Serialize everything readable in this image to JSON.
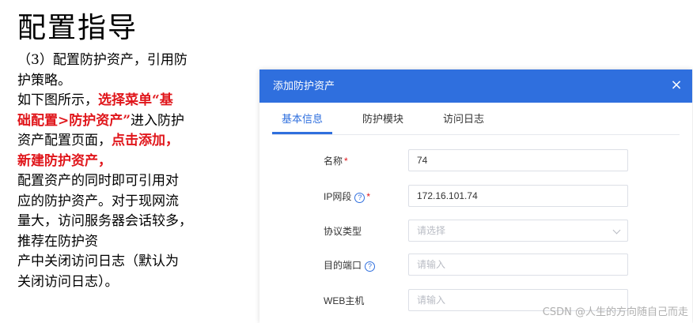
{
  "page_title": "配置指导",
  "instructions": {
    "line1": "（3）配置防护资产，引用防",
    "line2": "护策略。",
    "line3_a": "如下图所示，",
    "line3_b": "选择菜单“基",
    "line4_a": "础配置>防护资产”",
    "line4_b": "进入防护",
    "line5_a": "资产配置页面，",
    "line5_b": "点击添加，",
    "line6": "新建防护资产，",
    "line7": "配置资产的同时即可引用对",
    "line8": "应的防护资产。对于现网流",
    "line9": "量大，访问服务器会话较多，",
    "line10": "推荐在防护资",
    "line11": "产中关闭访问日志（默认为",
    "line12": "关闭访问日志）。"
  },
  "dialog": {
    "title": "添加防护资产",
    "close_icon": "×",
    "tabs": [
      {
        "label": "基本信息",
        "active": true
      },
      {
        "label": "防护模块",
        "active": false
      },
      {
        "label": "访问日志",
        "active": false
      }
    ],
    "fields": {
      "name": {
        "label": "名称",
        "required_mark": "*",
        "value": "74"
      },
      "ip_segment": {
        "label": "IP网段",
        "help_icon": "?",
        "required_mark": "*",
        "value": "172.16.101.74"
      },
      "protocol": {
        "label": "协议类型",
        "placeholder": "请选择"
      },
      "dest_port": {
        "label": "目的端口",
        "help_icon": "?",
        "placeholder": "请输入"
      },
      "web_host": {
        "label": "WEB主机",
        "placeholder": "请输入"
      }
    }
  },
  "watermark": "CSDN @人生的方向随自己而走"
}
